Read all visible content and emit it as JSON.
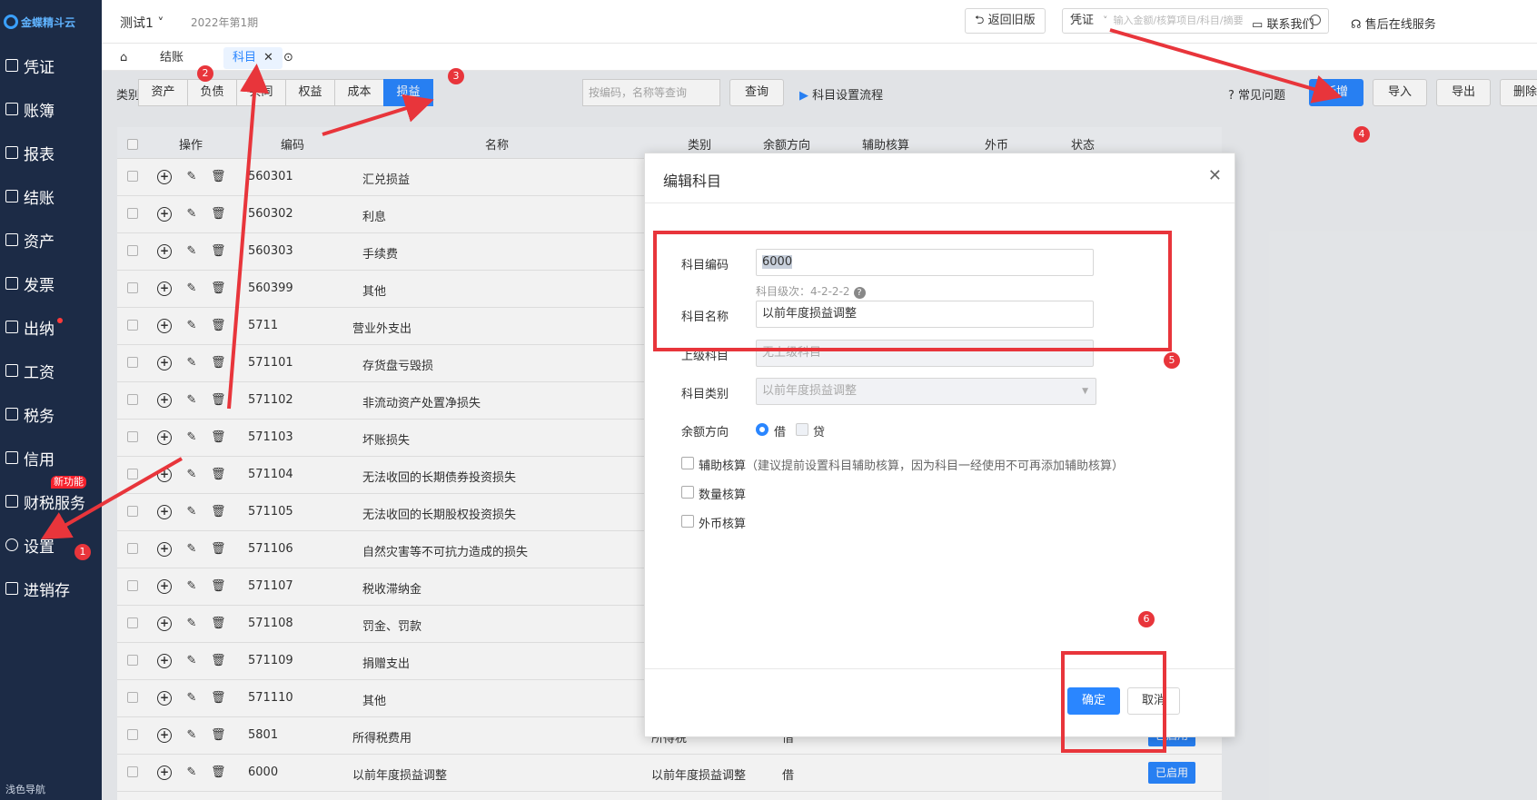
{
  "app": {
    "logo": "金蝶精斗云",
    "company": "测试1",
    "period": "2022年第1期"
  },
  "sidebar": {
    "items": [
      {
        "label": "凭证"
      },
      {
        "label": "账簿"
      },
      {
        "label": "报表"
      },
      {
        "label": "结账"
      },
      {
        "label": "资产"
      },
      {
        "label": "发票"
      },
      {
        "label": "出纳"
      },
      {
        "label": "工资"
      },
      {
        "label": "税务"
      },
      {
        "label": "信用"
      },
      {
        "label": "财税服务"
      },
      {
        "label": "设置"
      },
      {
        "label": "进销存"
      }
    ],
    "new_badge": "新功能",
    "guide": "浅色导航"
  },
  "header": {
    "back_old": "返回旧版",
    "search_kind": "凭证",
    "search_placeholder": "输入金额/核算项目/科目/摘要",
    "contact": "联系我们",
    "support": "售后在线服务"
  },
  "tabs": [
    {
      "label": "结账"
    },
    {
      "label": "科目"
    }
  ],
  "filter": {
    "label": "类别",
    "categories": [
      "资产",
      "负债",
      "共同",
      "权益",
      "成本",
      "损益"
    ],
    "active": "损益",
    "search_placeholder": "按编码，名称等查询",
    "query": "查询",
    "flow": "科目设置流程",
    "faq": "常见问题",
    "add": "新增",
    "import": "导入",
    "export": "导出",
    "delete": "删除"
  },
  "table": {
    "headers": [
      "操作",
      "编码",
      "名称",
      "类别",
      "余额方向",
      "辅助核算",
      "外币",
      "状态"
    ],
    "rows": [
      {
        "code": "560301",
        "name": "汇兑损益",
        "type": "",
        "dir": "",
        "status": ""
      },
      {
        "code": "560302",
        "name": "利息",
        "type": "",
        "dir": "",
        "status": ""
      },
      {
        "code": "560303",
        "name": "手续费",
        "type": "",
        "dir": "",
        "status": ""
      },
      {
        "code": "560399",
        "name": "其他",
        "type": "",
        "dir": "",
        "status": ""
      },
      {
        "code": "5711",
        "name": "营业外支出",
        "type": "",
        "dir": "",
        "status": ""
      },
      {
        "code": "571101",
        "name": "存货盘亏毁损",
        "type": "",
        "dir": "",
        "status": ""
      },
      {
        "code": "571102",
        "name": "非流动资产处置净损失",
        "type": "",
        "dir": "",
        "status": ""
      },
      {
        "code": "571103",
        "name": "坏账损失",
        "type": "",
        "dir": "",
        "status": ""
      },
      {
        "code": "571104",
        "name": "无法收回的长期债券投资损失",
        "type": "",
        "dir": "",
        "status": ""
      },
      {
        "code": "571105",
        "name": "无法收回的长期股权投资损失",
        "type": "",
        "dir": "",
        "status": ""
      },
      {
        "code": "571106",
        "name": "自然灾害等不可抗力造成的损失",
        "type": "",
        "dir": "",
        "status": ""
      },
      {
        "code": "571107",
        "name": "税收滞纳金",
        "type": "",
        "dir": "",
        "status": ""
      },
      {
        "code": "571108",
        "name": "罚金、罚款",
        "type": "",
        "dir": "",
        "status": ""
      },
      {
        "code": "571109",
        "name": "捐赠支出",
        "type": "",
        "dir": "",
        "status": ""
      },
      {
        "code": "571110",
        "name": "其他",
        "type": "",
        "dir": "",
        "status": ""
      },
      {
        "code": "5801",
        "name": "所得税费用",
        "type": "所得税",
        "dir": "借",
        "status": "已启用"
      },
      {
        "code": "6000",
        "name": "以前年度损益调整",
        "type": "以前年度损益调整",
        "dir": "借",
        "status": "已启用"
      }
    ]
  },
  "modal": {
    "title": "编辑科目",
    "code_label": "科目编码",
    "code_value": "6000",
    "level_hint": "科目级次：4-2-2-2",
    "name_label": "科目名称",
    "name_value": "以前年度损益调整",
    "parent_label": "上级科目",
    "parent_placeholder": "无上级科目",
    "type_label": "科目类别",
    "type_value": "以前年度损益调整",
    "balance_label": "余额方向",
    "debit": "借",
    "credit": "贷",
    "aux_label": "辅助核算",
    "aux_note": "（建议提前设置科目辅助核算，因为科目一经使用不可再添加辅助核算）",
    "qty_label": "数量核算",
    "fx_label": "外币核算",
    "ok": "确定",
    "cancel": "取消"
  },
  "annotations": {
    "steps": [
      "1",
      "2",
      "3",
      "4",
      "5",
      "6"
    ],
    "color": "#e8353b"
  }
}
